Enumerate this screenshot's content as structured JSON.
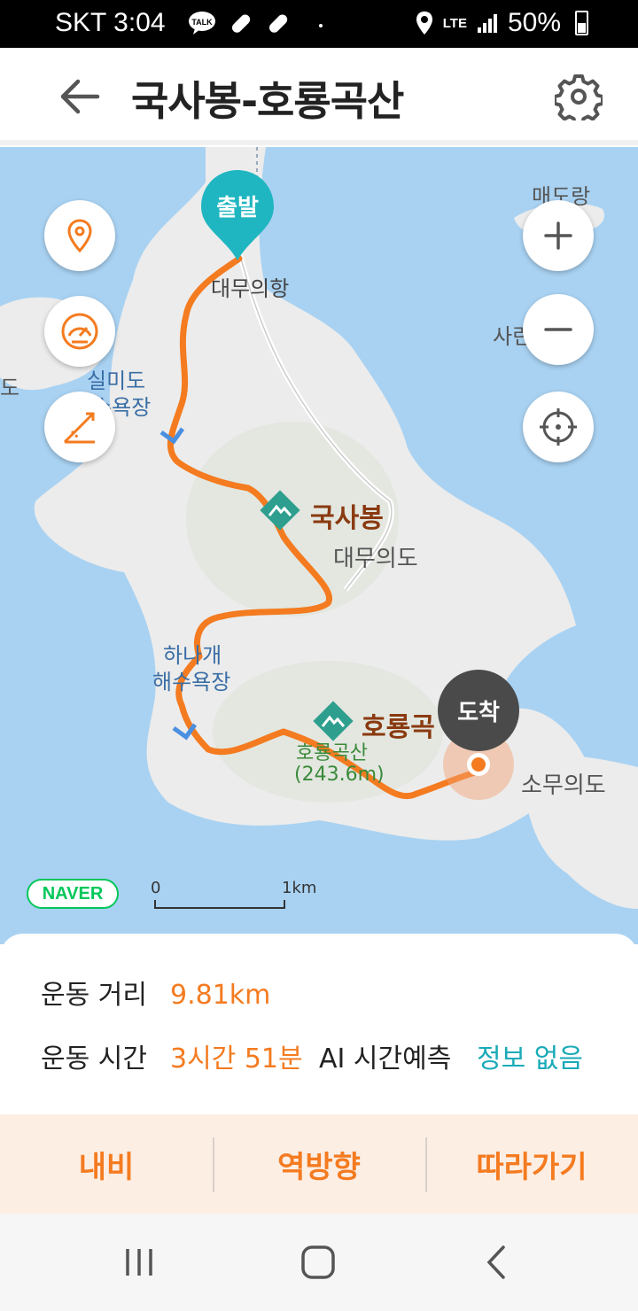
{
  "status_bar": {
    "carrier": "SKT",
    "time": "3:04",
    "notification_icons": [
      "kakaotalk-icon",
      "pill-icon",
      "pill-icon",
      "dot-icon"
    ],
    "network": "LTE",
    "battery": "50%"
  },
  "header": {
    "title": "국사봉-호룡곡산"
  },
  "map": {
    "start_marker": "출발",
    "end_marker": "도착",
    "labels": {
      "harbor": "대무의항",
      "beach1_a": "실미도",
      "beach1_b": "해수욕장",
      "beach2_a": "하나개",
      "beach2_b": "해수욕장",
      "island_main": "대무의도",
      "island_small": "소무의도",
      "island_top": "매도랑",
      "island_side": "사린",
      "left_edge": "도",
      "peak1": "국사봉",
      "peak2": "호룡곡",
      "peak2_sub": "호룡곡산",
      "peak2_height": "(243.6m)"
    },
    "brand": "NAVER",
    "scale_start": "0",
    "scale_end": "1km"
  },
  "info": {
    "distance_label": "운동 거리",
    "distance_value": "9.81km",
    "time_label": "운동 시간",
    "time_value": "3시간 51분",
    "ai_label": "AI 시간예측",
    "ai_value": "정보 없음"
  },
  "actions": {
    "navi": "내비",
    "reverse": "역방향",
    "follow": "따라가기"
  },
  "colors": {
    "route": "#f47b20",
    "accent_teal": "#1aaab8",
    "sea": "#a9d2f2",
    "land": "#ececec"
  }
}
